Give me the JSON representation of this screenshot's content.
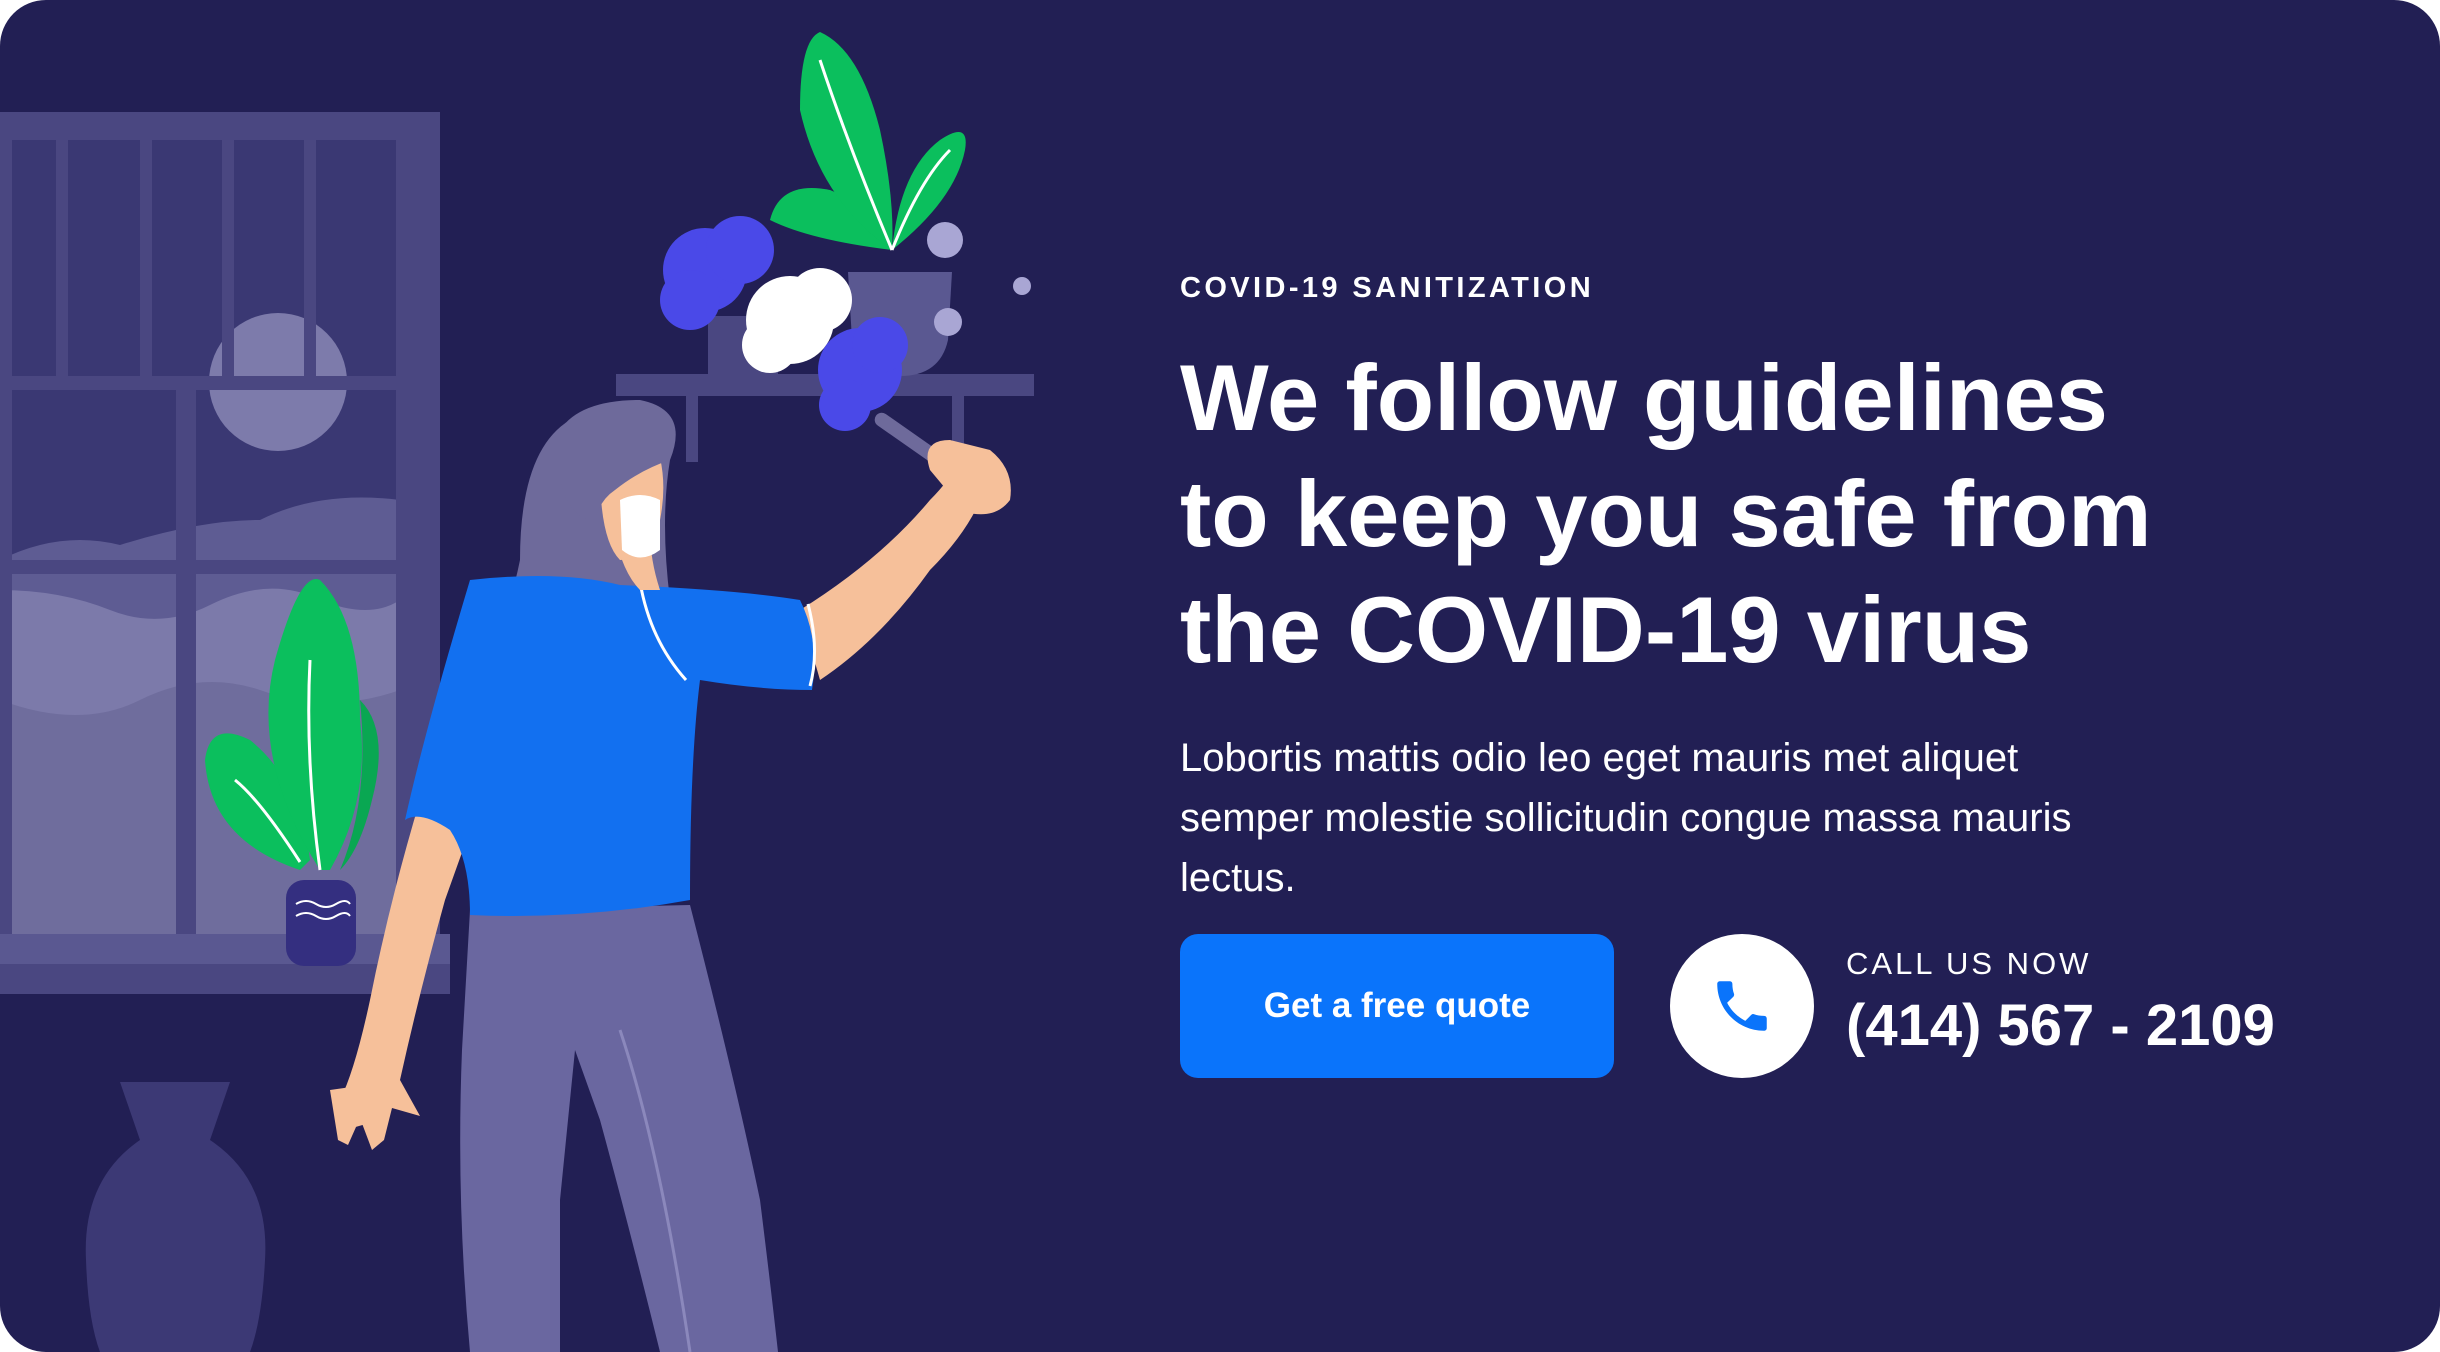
{
  "hero": {
    "eyebrow": "COVID-19 SANITIZATION",
    "headline": "We follow guidelines to keep you safe from the COVID-19 virus",
    "body": "Lobortis mattis odio leo eget mauris met aliquet semper molestie sollicitudin congue massa mauris lectus.",
    "cta_label": "Get a free quote",
    "call_label": "CALL US NOW",
    "phone_number": "(414) 567 - 2109",
    "phone_icon": "phone-icon"
  },
  "illustration": {
    "subject": "woman-dusting-shelf-illustration",
    "icons": [
      "window-icon",
      "moon-icon",
      "plant-icon",
      "vase-icon",
      "feather-duster-icon"
    ]
  },
  "colors": {
    "background": "#221f54",
    "accent": "#0a74fb",
    "text": "#ffffff",
    "plant_green": "#0bbf5d",
    "shirt_blue": "#1270f0"
  }
}
